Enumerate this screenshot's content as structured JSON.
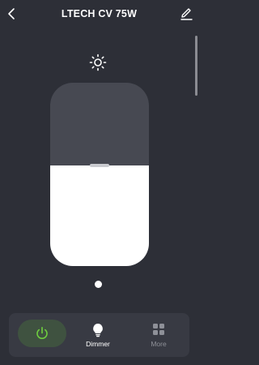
{
  "header": {
    "title": "LTECH CV 75W",
    "back_icon": "chevron-left-icon",
    "edit_icon": "pencil-icon"
  },
  "brightness": {
    "icon": "sun-icon",
    "level_percent": 55
  },
  "pager": {
    "current": 1,
    "total": 1
  },
  "bottom_bar": {
    "power": {
      "icon": "power-icon",
      "state": "on",
      "color": "#6fcf3f"
    },
    "dimmer": {
      "label": "Dimmer",
      "icon": "bulb-icon"
    },
    "more": {
      "label": "More",
      "icon": "grid-icon"
    }
  },
  "colors": {
    "background": "#2d2f37",
    "slider_track": "#474952",
    "slider_fill": "#ffffff",
    "accent_green": "#6fcf3f"
  }
}
